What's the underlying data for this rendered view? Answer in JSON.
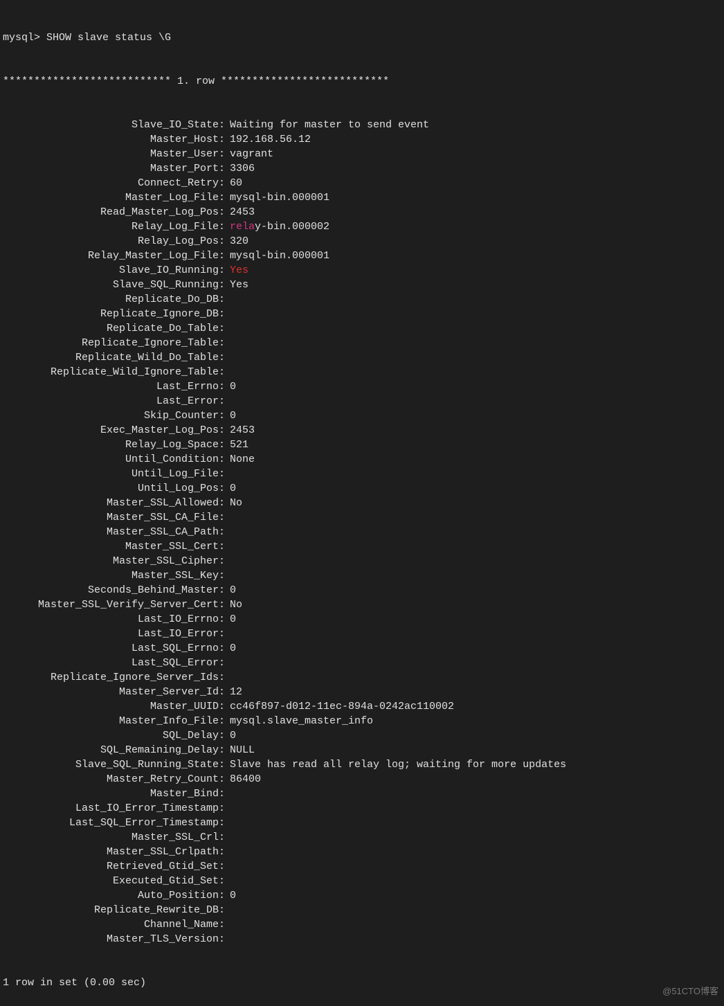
{
  "prompt": "mysql> SHOW slave status \\G",
  "row_header": "*************************** 1. row ***************************",
  "fields": [
    {
      "label": "Slave_IO_State",
      "value": "Waiting for master to send event"
    },
    {
      "label": "Master_Host",
      "value": "192.168.56.12"
    },
    {
      "label": "Master_User",
      "value": "vagrant"
    },
    {
      "label": "Master_Port",
      "value": "3306"
    },
    {
      "label": "Connect_Retry",
      "value": "60"
    },
    {
      "label": "Master_Log_File",
      "value": "mysql-bin.000001"
    },
    {
      "label": "Read_Master_Log_Pos",
      "value": "2453"
    },
    {
      "label": "Relay_Log_File",
      "value": "relay-bin.000002",
      "hl_prefix": "rela",
      "hl_color": "magenta",
      "hl_rest": "y-bin.000002"
    },
    {
      "label": "Relay_Log_Pos",
      "value": "320"
    },
    {
      "label": "Relay_Master_Log_File",
      "value": "mysql-bin.000001"
    },
    {
      "label": "Slave_IO_Running",
      "value": "Yes",
      "hl_color": "red"
    },
    {
      "label": "Slave_SQL_Running",
      "value": "Yes"
    },
    {
      "label": "Replicate_Do_DB",
      "value": ""
    },
    {
      "label": "Replicate_Ignore_DB",
      "value": ""
    },
    {
      "label": "Replicate_Do_Table",
      "value": ""
    },
    {
      "label": "Replicate_Ignore_Table",
      "value": ""
    },
    {
      "label": "Replicate_Wild_Do_Table",
      "value": ""
    },
    {
      "label": "Replicate_Wild_Ignore_Table",
      "value": ""
    },
    {
      "label": "Last_Errno",
      "value": "0"
    },
    {
      "label": "Last_Error",
      "value": ""
    },
    {
      "label": "Skip_Counter",
      "value": "0"
    },
    {
      "label": "Exec_Master_Log_Pos",
      "value": "2453"
    },
    {
      "label": "Relay_Log_Space",
      "value": "521"
    },
    {
      "label": "Until_Condition",
      "value": "None"
    },
    {
      "label": "Until_Log_File",
      "value": ""
    },
    {
      "label": "Until_Log_Pos",
      "value": "0"
    },
    {
      "label": "Master_SSL_Allowed",
      "value": "No"
    },
    {
      "label": "Master_SSL_CA_File",
      "value": ""
    },
    {
      "label": "Master_SSL_CA_Path",
      "value": ""
    },
    {
      "label": "Master_SSL_Cert",
      "value": ""
    },
    {
      "label": "Master_SSL_Cipher",
      "value": ""
    },
    {
      "label": "Master_SSL_Key",
      "value": ""
    },
    {
      "label": "Seconds_Behind_Master",
      "value": "0"
    },
    {
      "label": "Master_SSL_Verify_Server_Cert",
      "value": "No"
    },
    {
      "label": "Last_IO_Errno",
      "value": "0"
    },
    {
      "label": "Last_IO_Error",
      "value": ""
    },
    {
      "label": "Last_SQL_Errno",
      "value": "0"
    },
    {
      "label": "Last_SQL_Error",
      "value": ""
    },
    {
      "label": "Replicate_Ignore_Server_Ids",
      "value": ""
    },
    {
      "label": "Master_Server_Id",
      "value": "12"
    },
    {
      "label": "Master_UUID",
      "value": "cc46f897-d012-11ec-894a-0242ac110002"
    },
    {
      "label": "Master_Info_File",
      "value": "mysql.slave_master_info"
    },
    {
      "label": "SQL_Delay",
      "value": "0"
    },
    {
      "label": "SQL_Remaining_Delay",
      "value": "NULL"
    },
    {
      "label": "Slave_SQL_Running_State",
      "value": "Slave has read all relay log; waiting for more updates"
    },
    {
      "label": "Master_Retry_Count",
      "value": "86400"
    },
    {
      "label": "Master_Bind",
      "value": ""
    },
    {
      "label": "Last_IO_Error_Timestamp",
      "value": ""
    },
    {
      "label": "Last_SQL_Error_Timestamp",
      "value": ""
    },
    {
      "label": "Master_SSL_Crl",
      "value": ""
    },
    {
      "label": "Master_SSL_Crlpath",
      "value": ""
    },
    {
      "label": "Retrieved_Gtid_Set",
      "value": ""
    },
    {
      "label": "Executed_Gtid_Set",
      "value": ""
    },
    {
      "label": "Auto_Position",
      "value": "0"
    },
    {
      "label": "Replicate_Rewrite_DB",
      "value": ""
    },
    {
      "label": "Channel_Name",
      "value": ""
    },
    {
      "label": "Master_TLS_Version",
      "value": ""
    }
  ],
  "footer": "1 row in set (0.00 sec)",
  "watermark": "@51CTO博客"
}
